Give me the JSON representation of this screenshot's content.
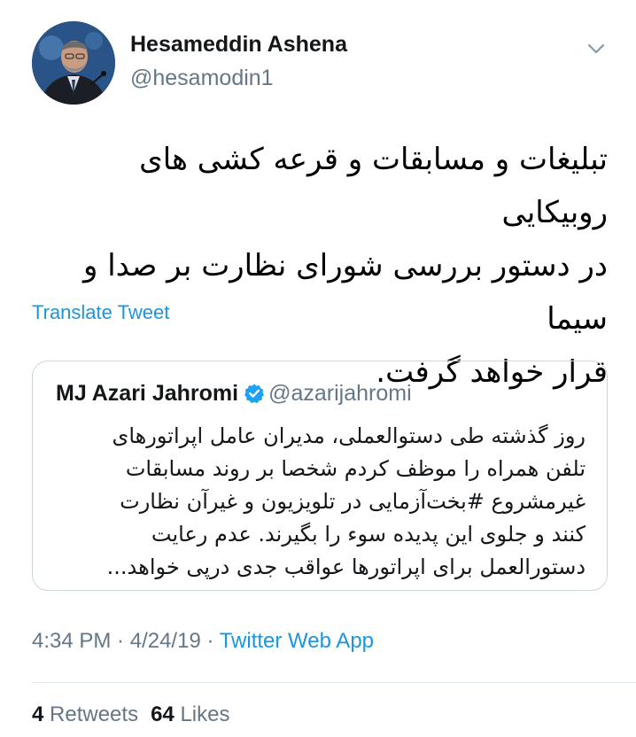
{
  "author": {
    "name": "Hesameddin Ashena",
    "handle": "@hesamodin1",
    "avatar_icon": "profile-photo"
  },
  "tweet": {
    "lines": [
      "تبلیغات و مسابقات و قرعه کشی های روبیکایی",
      "در دستور بررسی شورای نظارت بر صدا و سیما",
      "قرار خواهد گرفت."
    ],
    "translate_label": "Translate Tweet"
  },
  "quoted": {
    "name": "MJ Azari Jahromi",
    "handle": "@azarijahromi",
    "verified_icon": "verified-badge-icon",
    "lines": [
      "روز گذشته طی دستوالعملی، مدیران عامل اپراتورهای",
      "تلفن همراه را موظف کردم شخصا بر روند مسابقات",
      "غیرمشروع #بخت‌آزمایی در تلویزیون و غیرآن نظارت",
      "کنند و جلوی این پدیده سوء را بگیرند. عدم رعایت",
      "دستورالعمل برای اپراتورها عواقب جدی درپی خواهد..."
    ]
  },
  "meta": {
    "time": "4:34 PM",
    "separator": " · ",
    "date": "4/24/19",
    "app": "Twitter Web App"
  },
  "stats": {
    "retweets_count": "4",
    "retweets_label": "Retweets",
    "likes_count": "64",
    "likes_label": "Likes"
  },
  "colors": {
    "link": "#1b95e0",
    "secondary_text": "#657786",
    "verified": "#1da1f2",
    "border": "#ccd6dd"
  }
}
